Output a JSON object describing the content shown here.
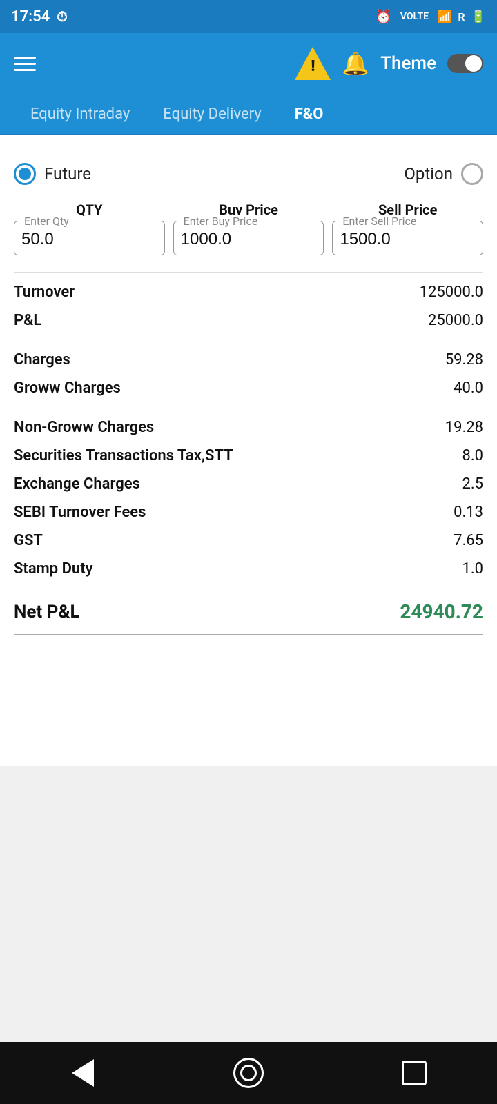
{
  "statusBar": {
    "time": "17:54",
    "icons": [
      "clock",
      "data",
      "signal",
      "R",
      "battery"
    ]
  },
  "header": {
    "themeLabel": "Theme",
    "warningTitle": "Warning"
  },
  "tabs": [
    {
      "id": "equity-intraday",
      "label": "Equity Intraday",
      "active": false
    },
    {
      "id": "equity-delivery",
      "label": "Equity Delivery",
      "active": false
    },
    {
      "id": "fno",
      "label": "F&O",
      "active": true
    }
  ],
  "tradeType": {
    "options": [
      {
        "id": "future",
        "label": "Future",
        "selected": true
      },
      {
        "id": "option",
        "label": "Option",
        "selected": false
      }
    ]
  },
  "inputs": {
    "qty": {
      "label": "QTY",
      "fieldLabel": "Enter Qty",
      "value": "50.0"
    },
    "buyPrice": {
      "label": "Buy Price",
      "fieldLabel": "Enter Buy Price",
      "value": "1000.0"
    },
    "sellPrice": {
      "label": "Sell Price",
      "fieldLabel": "Enter Sell Price",
      "value": "1500.0"
    }
  },
  "results": [
    {
      "id": "turnover",
      "label": "Turnover",
      "value": "125000.0"
    },
    {
      "id": "pnl",
      "label": "P&L",
      "value": "25000.0"
    },
    {
      "id": "charges",
      "label": "Charges",
      "value": "59.28"
    },
    {
      "id": "groww-charges",
      "label": "Groww Charges",
      "value": "40.0"
    },
    {
      "id": "non-groww-charges",
      "label": "Non-Groww Charges",
      "value": "19.28"
    },
    {
      "id": "stt",
      "label": "Securities Transactions Tax,STT",
      "value": "8.0"
    },
    {
      "id": "exchange-charges",
      "label": "Exchange Charges",
      "value": "2.5"
    },
    {
      "id": "sebi-fees",
      "label": "SEBI Turnover Fees",
      "value": "0.13"
    },
    {
      "id": "gst",
      "label": "GST",
      "value": "7.65"
    },
    {
      "id": "stamp-duty",
      "label": "Stamp Duty",
      "value": "1.0"
    }
  ],
  "netPnl": {
    "label": "Net P&L",
    "value": "24940.72"
  },
  "nav": {
    "back": "back",
    "home": "home",
    "recents": "recents"
  }
}
